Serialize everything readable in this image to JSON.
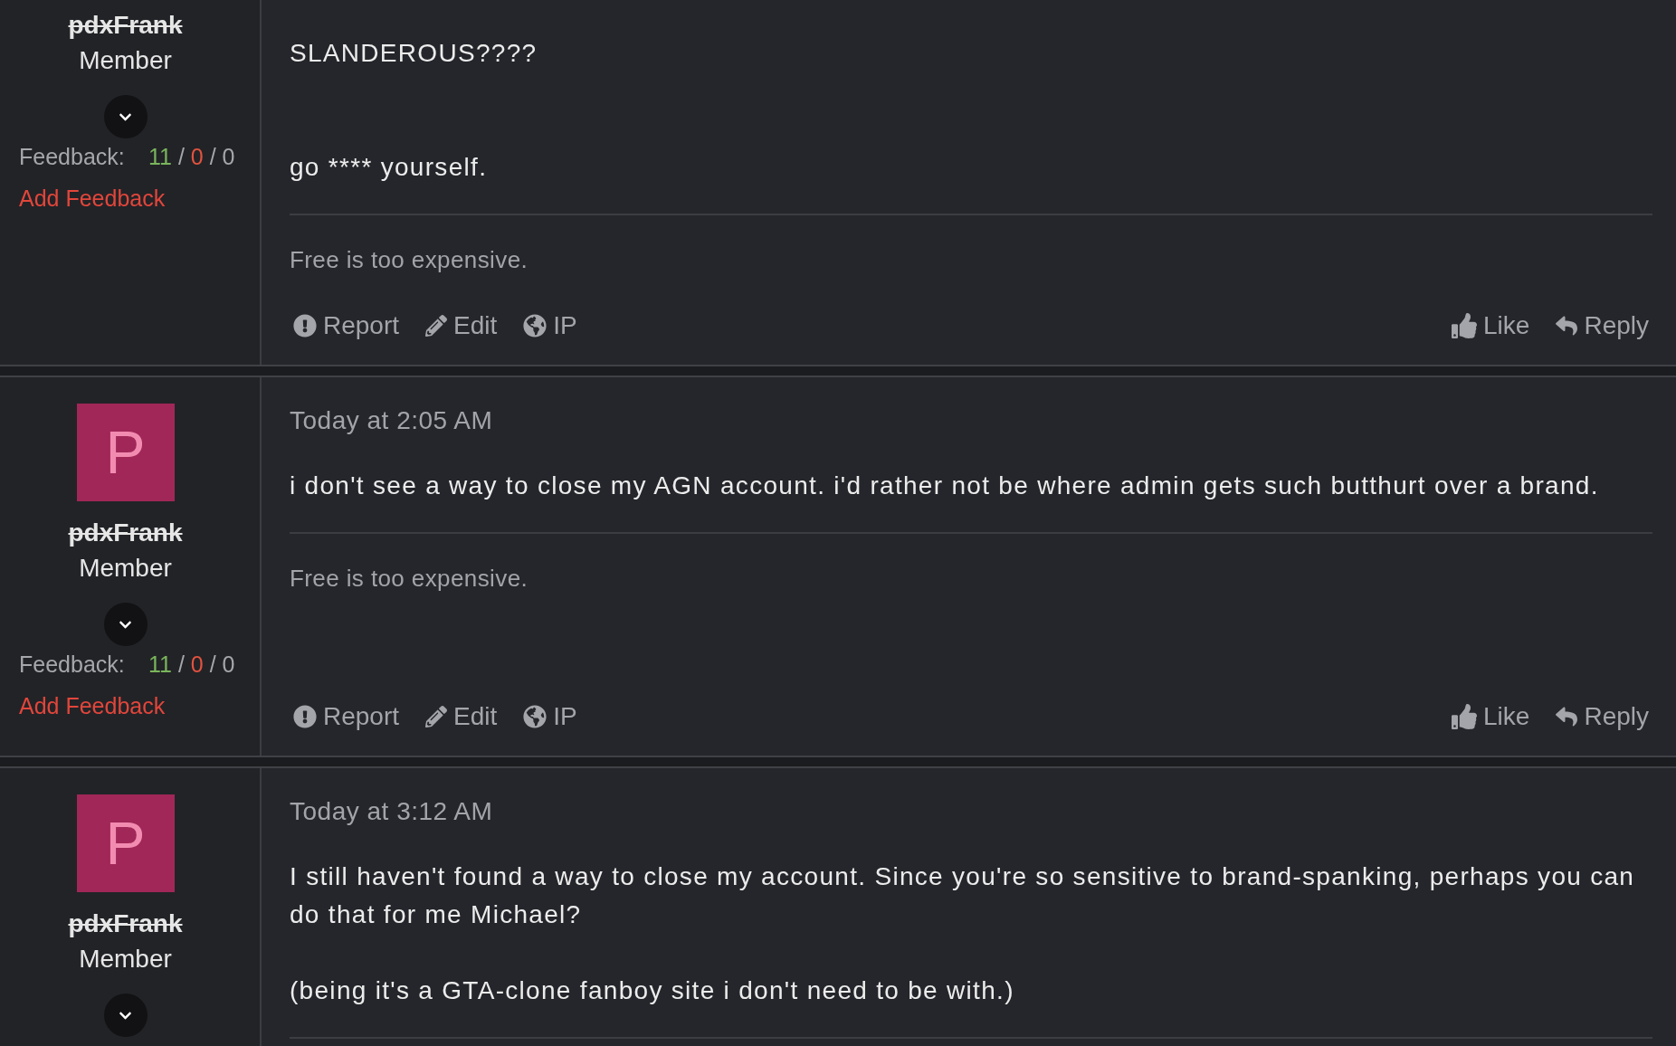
{
  "posts": [
    {
      "user": {
        "username": "pdxFrank",
        "strikethrough": true,
        "role": "Member",
        "expanded": false
      },
      "feedback": {
        "label": "Feedback:",
        "separator": "/",
        "counts": [
          {
            "value": "11",
            "kind": "positive"
          },
          {
            "value": "0",
            "kind": "negative"
          },
          {
            "value": "0",
            "kind": "neutral"
          }
        ]
      },
      "add_feedback": "Add Feedback",
      "text": "SLANDEROUS????\n\n\ngo **** yourself.",
      "signature": "Free is too expensive.",
      "actions": {
        "left": [
          "Report",
          "Edit",
          "IP"
        ],
        "right": [
          "Like",
          "Reply"
        ]
      }
    },
    {
      "user": {
        "avatar": "P",
        "username": "pdxFrank",
        "strikethrough": true,
        "role": "Member",
        "expanded": false
      },
      "feedback": {
        "label": "Feedback:",
        "separator": "/",
        "counts": [
          {
            "value": "11",
            "kind": "positive"
          },
          {
            "value": "0",
            "kind": "negative"
          },
          {
            "value": "0",
            "kind": "neutral"
          }
        ]
      },
      "add_feedback": "Add Feedback",
      "timestamp": "Today at 2:05 AM",
      "text": "i don't see a way to close my AGN account. i'd rather not be where admin gets such butthurt over a brand.",
      "signature": "Free is too expensive.",
      "actions": {
        "left": [
          "Report",
          "Edit",
          "IP"
        ],
        "right": [
          "Like",
          "Reply"
        ]
      }
    },
    {
      "user": {
        "avatar": "P",
        "username": "pdxFrank",
        "strikethrough": true,
        "role": "Member",
        "expanded": false
      },
      "timestamp": "Today at 3:12 AM",
      "text": "I still haven't found a way to close my account. Since you're so sensitive to brand-spanking, perhaps you can do that for me Michael?\n\n(being it's a GTA-clone fanboy site i don't need to be with.)"
    }
  ]
}
